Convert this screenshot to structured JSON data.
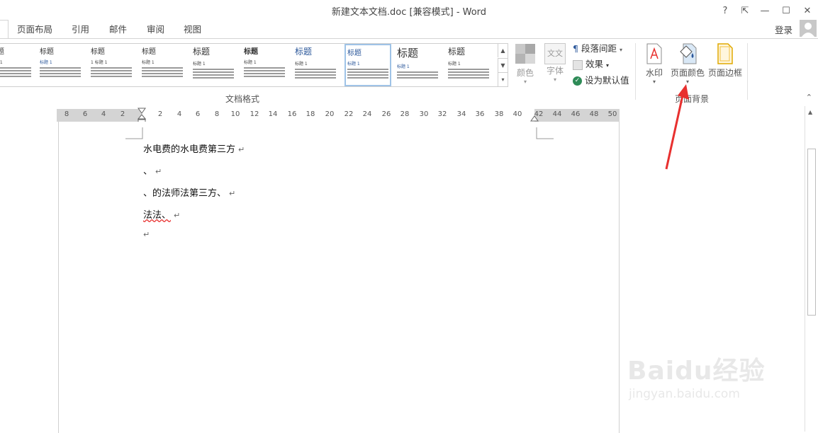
{
  "window": {
    "title": "新建文本文档.doc [兼容模式] - Word",
    "help": "?",
    "restore_ribbon": "⇱",
    "minimize": "—",
    "maximize": "☐",
    "close": "✕"
  },
  "tabs": [
    "页面布局",
    "引用",
    "邮件",
    "审阅",
    "视图"
  ],
  "login": "登录",
  "styles_gallery": [
    {
      "h1": "标题",
      "h2": "标题 1"
    },
    {
      "h1": "标题",
      "h2": "标题 1"
    },
    {
      "h1": "标题",
      "h2": "1 标题 1"
    },
    {
      "h1": "标题",
      "h2": "标题 1"
    },
    {
      "h1": "标题",
      "h2": "标题 1"
    },
    {
      "h1": "标题",
      "h2": "标题 1"
    },
    {
      "h1": "标题",
      "h2": "标题 1"
    },
    {
      "h1": "标题",
      "h2": "标题 1"
    },
    {
      "h1": "标题",
      "h2": "标题 1"
    }
  ],
  "groups": {
    "document_format": "文档格式",
    "page_background": "页面背景"
  },
  "buttons": {
    "colors": "颜色",
    "fonts": "字体",
    "fonts_icon_text": "文文",
    "paragraph_spacing": "段落间距",
    "effects": "效果",
    "set_default": "设为默认值",
    "watermark": "水印",
    "page_color": "页面颜色",
    "page_borders": "页面边框"
  },
  "ruler": [
    "8",
    "6",
    "4",
    "2",
    "",
    "2",
    "4",
    "6",
    "8",
    "10",
    "12",
    "14",
    "16",
    "18",
    "20",
    "22",
    "24",
    "26",
    "28",
    "30",
    "32",
    "34",
    "36",
    "38",
    "40",
    "42",
    "44",
    "46",
    "48",
    "50"
  ],
  "document": {
    "paragraphs": [
      "水电费的水电费第三方",
      "、",
      "、的法师法第三方、",
      "法法、",
      ""
    ],
    "para_mark": "↵"
  },
  "watermark": {
    "brand": "Baidu经验",
    "url": "jingyan.baidu.com"
  },
  "colors": {
    "accent_word_blue": "#2b579a",
    "arrow_red": "#e8302f",
    "selected_style_border": "#9fc3e7"
  }
}
